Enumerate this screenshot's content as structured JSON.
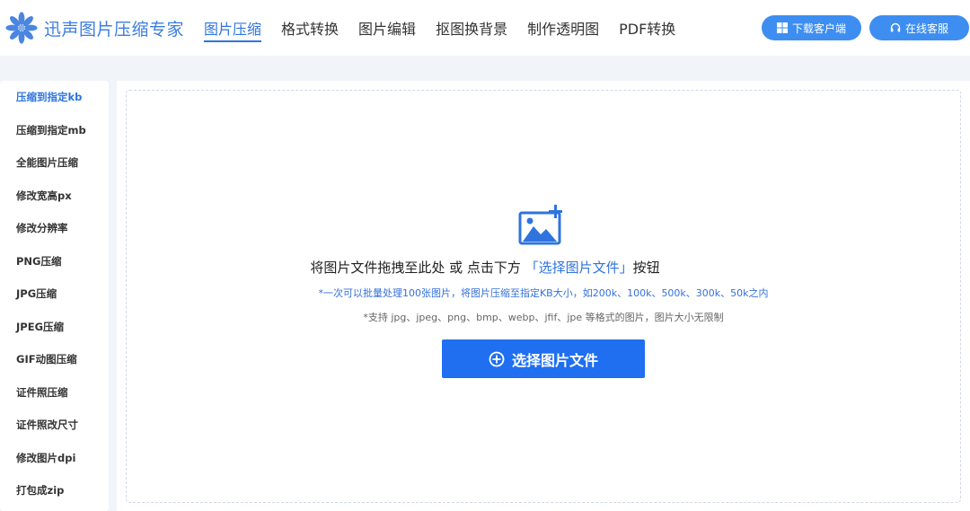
{
  "brand": {
    "name": "迅声图片压缩专家",
    "color": "#3b7ee0"
  },
  "nav": {
    "items": [
      {
        "label": "图片压缩",
        "active": true
      },
      {
        "label": "格式转换"
      },
      {
        "label": "图片编辑"
      },
      {
        "label": "抠图换背景"
      },
      {
        "label": "制作透明图"
      },
      {
        "label": "PDF转换"
      }
    ]
  },
  "header_buttons": {
    "download": {
      "label": "下载客户端",
      "icon": "windows-icon"
    },
    "service": {
      "label": "在线客服",
      "icon": "headset-icon"
    }
  },
  "sidebar": {
    "items": [
      {
        "label": "压缩到指定kb",
        "active": true
      },
      {
        "label": "压缩到指定mb"
      },
      {
        "label": "全能图片压缩"
      },
      {
        "label": "修改宽高px"
      },
      {
        "label": "修改分辨率"
      },
      {
        "label": "PNG压缩"
      },
      {
        "label": "JPG压缩"
      },
      {
        "label": "JPEG压缩"
      },
      {
        "label": "GIF动图压缩"
      },
      {
        "label": "证件照压缩"
      },
      {
        "label": "证件照改尺寸"
      },
      {
        "label": "修改图片dpi"
      },
      {
        "label": "打包成zip"
      }
    ]
  },
  "dropzone": {
    "main_text_prefix": "将图片文件拖拽至此处 或 点击下方 ",
    "main_text_highlight": "「选择图片文件」",
    "main_text_suffix": "按钮",
    "hint_blue": "*一次可以批量处理100张图片，将图片压缩至指定KB大小，如200k、100k、500k、300k、50k之内",
    "hint_gray": "*支持 jpg、jpeg、png、bmp、webp、jfif、jpe 等格式的图片，图片大小无限制",
    "button_label": "选择图片文件",
    "button_icon": "plus-circle-icon",
    "upload_icon": "add-image-icon"
  },
  "colors": {
    "accent": "#2f74de",
    "button": "#1f6ff0",
    "header_button": "#3d8ef0"
  }
}
